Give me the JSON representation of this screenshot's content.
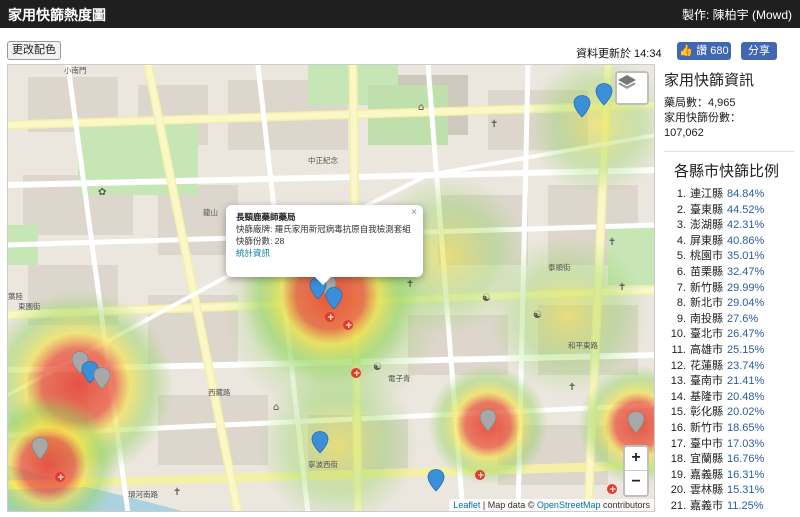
{
  "header": {
    "title": "家用快篩熱度圖",
    "credit": "製作: 陳柏宇 (Mowd)"
  },
  "toolbar": {
    "change_color_label": "更改配色",
    "updated_label": "資料更新於 14:34"
  },
  "social": {
    "like_label": "讚 680",
    "share_label": "分享"
  },
  "map": {
    "attribution_leaflet": "Leaflet",
    "attribution_sep1": " | Map data © ",
    "attribution_osm": "OpenStreetMap",
    "attribution_sep2": " contributors",
    "zoom_in": "+",
    "zoom_out": "−",
    "popup": {
      "name": "長頸鹿藥師藥局",
      "brand": "快篩廠牌: 羅氏家用新冠病毒抗原自我檢測套組",
      "count": "快篩份數: 28",
      "link": "統計資訊",
      "close": "×"
    },
    "labels": {
      "xiaonanmen": "小南門",
      "zhongzheng": "中正紀念",
      "longshan": "龍山",
      "dongyuan": "東園街",
      "yeliu": "葉陸",
      "xizang": "西藏路",
      "dianziqing": "電子青",
      "huanhe": "環河南路",
      "heping": "和平東路",
      "taishun": "泰順街",
      "ninghua": "寧波西街"
    }
  },
  "sidebar": {
    "info_title": "家用快篩資訊",
    "pharmacy_count": "藥局數：4,965",
    "kit_count_label": "家用快篩份數：",
    "kit_count": "107,062",
    "ratio_title": "各縣市快篩比例",
    "ratios": [
      {
        "rank": "1.",
        "name": "連江縣",
        "pct": "84.84%"
      },
      {
        "rank": "2.",
        "name": "臺東縣",
        "pct": "44.52%"
      },
      {
        "rank": "3.",
        "name": "澎湖縣",
        "pct": "42.31%"
      },
      {
        "rank": "4.",
        "name": "屏東縣",
        "pct": "40.86%"
      },
      {
        "rank": "5.",
        "name": "桃園市",
        "pct": "35.01%"
      },
      {
        "rank": "6.",
        "name": "苗栗縣",
        "pct": "32.47%"
      },
      {
        "rank": "7.",
        "name": "新竹縣",
        "pct": "29.99%"
      },
      {
        "rank": "8.",
        "name": "新北市",
        "pct": "29.04%"
      },
      {
        "rank": "9.",
        "name": "南投縣",
        "pct": "27.6%"
      },
      {
        "rank": "10.",
        "name": "臺北市",
        "pct": "26.47%"
      },
      {
        "rank": "11.",
        "name": "高雄市",
        "pct": "25.15%"
      },
      {
        "rank": "12.",
        "name": "花蓮縣",
        "pct": "23.74%"
      },
      {
        "rank": "13.",
        "name": "臺南市",
        "pct": "21.41%"
      },
      {
        "rank": "14.",
        "name": "基隆市",
        "pct": "20.48%"
      },
      {
        "rank": "15.",
        "name": "彰化縣",
        "pct": "20.02%"
      },
      {
        "rank": "16.",
        "name": "新竹市",
        "pct": "18.65%"
      },
      {
        "rank": "17.",
        "name": "臺中市",
        "pct": "17.03%"
      },
      {
        "rank": "18.",
        "name": "宜蘭縣",
        "pct": "16.76%"
      },
      {
        "rank": "19.",
        "name": "嘉義縣",
        "pct": "16.31%"
      },
      {
        "rank": "20.",
        "name": "雲林縣",
        "pct": "15.31%"
      },
      {
        "rank": "21.",
        "name": "嘉義市",
        "pct": "11.25%"
      }
    ]
  },
  "colors": {
    "topbar": "#1f1f1f",
    "facebook": "#4267b2",
    "link": "#2a5d9f",
    "marker_blue": "#3a8fd8",
    "marker_grey": "#a8a8a8",
    "heat_red": "#e83a2c",
    "heat_yellow": "#f2e23a",
    "heat_green": "#8fd35a"
  }
}
